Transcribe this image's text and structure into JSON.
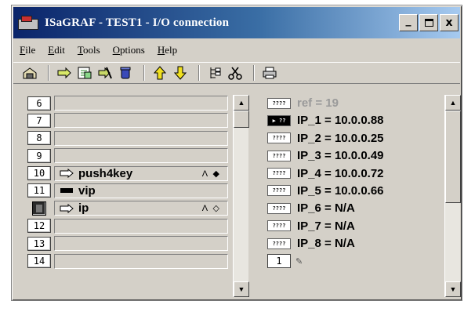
{
  "window": {
    "title": "ISaGRAF - TEST1 - I/O connection",
    "buttons": {
      "minimize": "_",
      "close": "x"
    }
  },
  "menu": [
    {
      "label": "File",
      "accel": "F",
      "rest": "ile"
    },
    {
      "label": "Edit",
      "accel": "E",
      "rest": "dit"
    },
    {
      "label": "Tools",
      "accel": "T",
      "rest": "ools"
    },
    {
      "label": "Options",
      "accel": "O",
      "rest": "ptions"
    },
    {
      "label": "Help",
      "accel": "H",
      "rest": "elp"
    }
  ],
  "toolbar": {
    "icons": [
      "board-icon",
      "connect-icon",
      "list-icon",
      "disconnect-icon",
      "delete-icon",
      "up-arrow-icon",
      "down-arrow-icon",
      "tree-icon",
      "cut-icon",
      "print-icon"
    ]
  },
  "slots": [
    {
      "num": "6",
      "device": "",
      "tags": ""
    },
    {
      "num": "7",
      "device": "",
      "tags": ""
    },
    {
      "num": "8",
      "device": "",
      "tags": ""
    },
    {
      "num": "9",
      "device": "",
      "tags": ""
    },
    {
      "num": "10",
      "device": "push4key",
      "tags": "Λ ◆"
    },
    {
      "num": "11",
      "device": "vip",
      "tags": ""
    },
    {
      "num": "",
      "device": "ip",
      "tags": "Λ ◇"
    },
    {
      "num": "12",
      "device": "",
      "tags": ""
    },
    {
      "num": "13",
      "device": "",
      "tags": ""
    },
    {
      "num": "14",
      "device": "",
      "tags": ""
    }
  ],
  "variables": [
    {
      "badge": "????",
      "text": "ref = 19",
      "dim": true
    },
    {
      "badge": "▶ ??",
      "text": "IP_1 = 10.0.0.88",
      "selected": true
    },
    {
      "badge": "????",
      "text": "IP_2 = 10.0.0.25"
    },
    {
      "badge": "????",
      "text": "IP_3 = 10.0.0.49"
    },
    {
      "badge": "????",
      "text": "IP_4 = 10.0.0.72"
    },
    {
      "badge": "????",
      "text": "IP_5 = 10.0.0.66"
    },
    {
      "badge": "????",
      "text": "IP_6 = N/A"
    },
    {
      "badge": "????",
      "text": "IP_7 = N/A"
    },
    {
      "badge": "????",
      "text": "IP_8 = N/A"
    }
  ],
  "channel": {
    "value": "1"
  }
}
